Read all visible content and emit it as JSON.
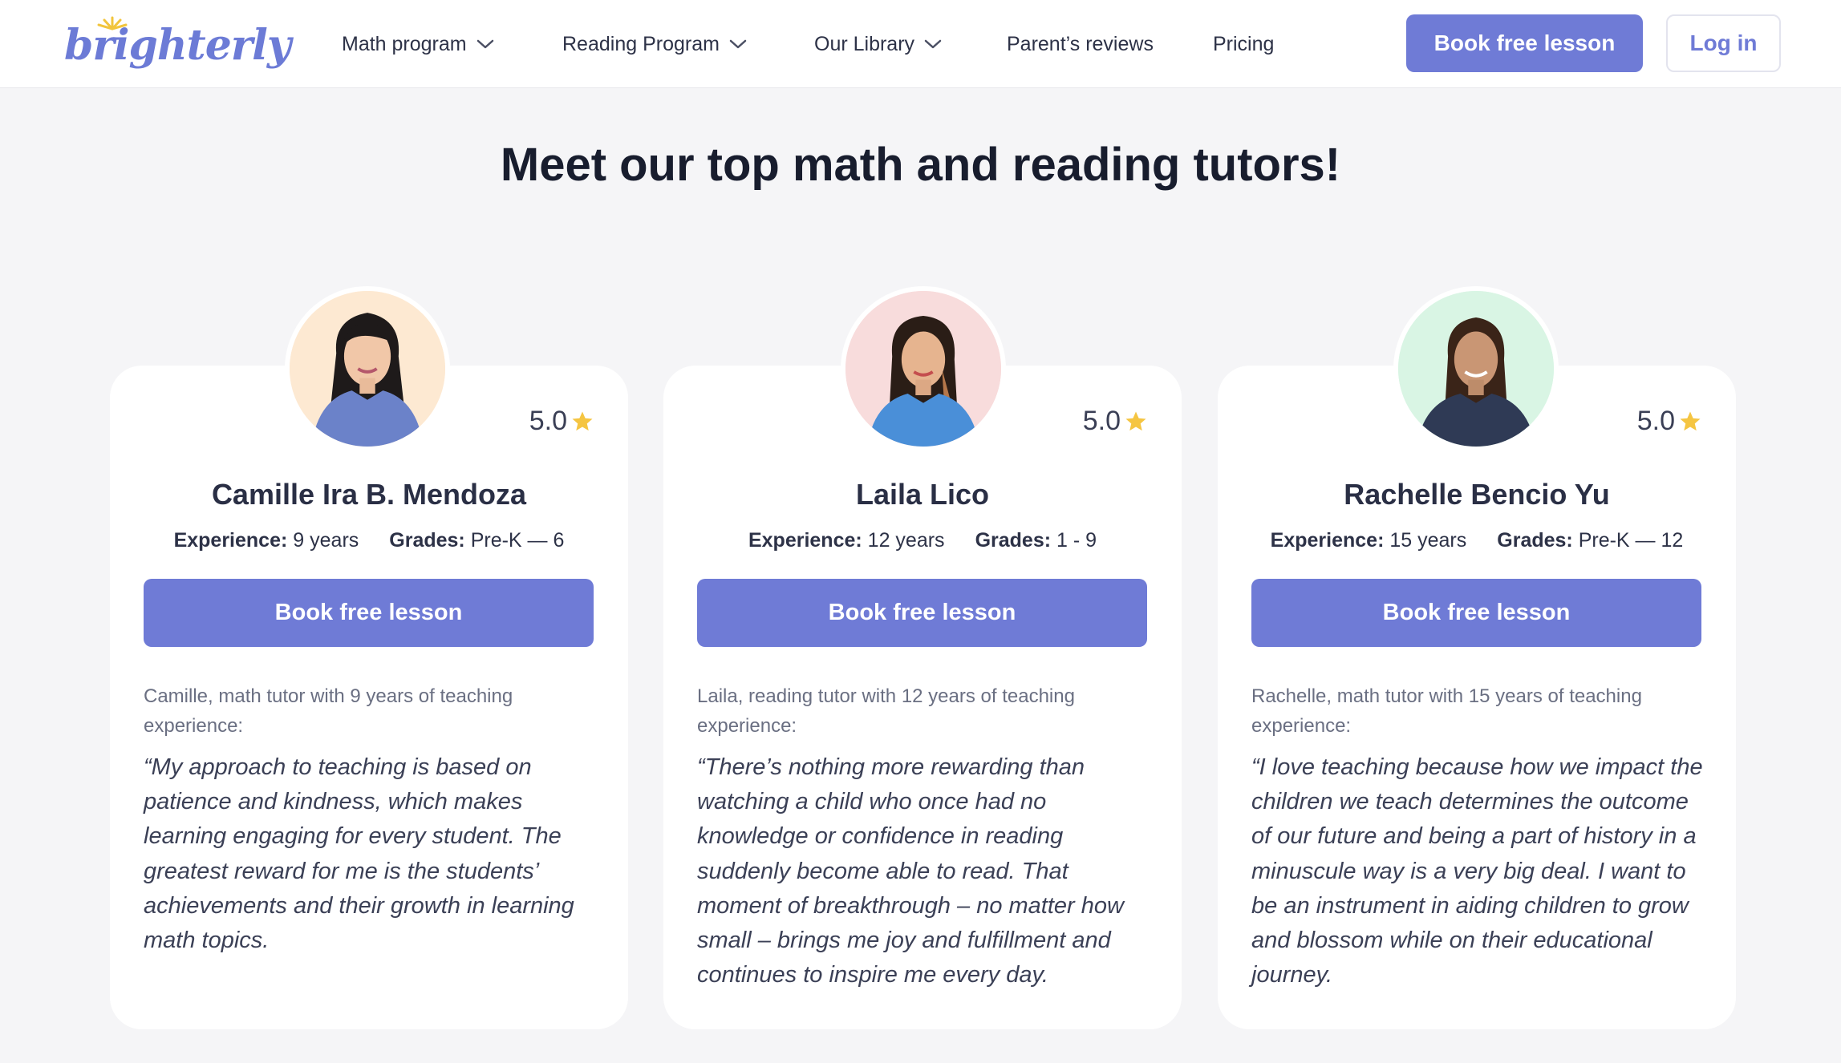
{
  "header": {
    "logo_text": "brighterly",
    "nav": [
      {
        "label": "Math program",
        "has_dropdown": true
      },
      {
        "label": "Reading Program",
        "has_dropdown": true
      },
      {
        "label": "Our Library",
        "has_dropdown": true
      },
      {
        "label": "Parent’s reviews",
        "has_dropdown": false
      },
      {
        "label": "Pricing",
        "has_dropdown": false
      }
    ],
    "book_button": "Book free lesson",
    "login_button": "Log in"
  },
  "section": {
    "title": "Meet our top math and reading tutors!"
  },
  "tutors": [
    {
      "name": "Camille Ira B. Mendoza",
      "rating": "5.0",
      "experience_label": "Experience:",
      "experience_value": "9 years",
      "grades_label": "Grades:",
      "grades_value": "Pre-K — 6",
      "button": "Book free lesson",
      "intro": "Camille, math tutor with 9 years of teaching experience:",
      "quote": "“My approach to teaching is based on patience and kindness, which makes learning engaging for every student. The greatest reward for me is the students’ achievements and their growth in learning math topics.",
      "avatar_bg": "#fde9d2",
      "shirt_color": "#6b82c9"
    },
    {
      "name": "Laila Lico",
      "rating": "5.0",
      "experience_label": "Experience:",
      "experience_value": "12 years",
      "grades_label": "Grades:",
      "grades_value": "1 - 9",
      "button": "Book free lesson",
      "intro": "Laila, reading tutor with 12 years of teaching experience:",
      "quote": "“There’s nothing more rewarding than watching a child who once had no knowledge or confidence in reading suddenly become able to read. That moment of breakthrough – no matter how small – brings me joy and fulfillment and continues to inspire me every day.",
      "avatar_bg": "#f8dcdc",
      "shirt_color": "#4a8fd8"
    },
    {
      "name": "Rachelle Bencio Yu",
      "rating": "5.0",
      "experience_label": "Experience:",
      "experience_value": "15 years",
      "grades_label": "Grades:",
      "grades_value": "Pre-K — 12",
      "button": "Book free lesson",
      "intro": "Rachelle, math tutor with 15 years of teaching experience:",
      "quote": "“I love teaching because how we impact the children we teach determines the outcome of our future and being a part of history in a minuscule way is a very big deal. I want to be an instrument in aiding children to grow and blossom while on their educational journey.",
      "avatar_bg": "#d9f5e4",
      "shirt_color": "#2f3a55"
    }
  ],
  "colors": {
    "brand": "#6f7bd6",
    "background": "#f5f5f7",
    "card": "#ffffff",
    "star": "#f5c542",
    "heading": "#181d2e"
  }
}
